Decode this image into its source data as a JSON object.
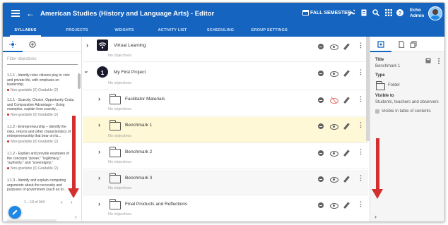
{
  "app": {
    "title": "American Studies (History and Language Arts) - Editor",
    "semester": "FALL SEMESTER",
    "user_first": "Echo",
    "user_last": "Admin"
  },
  "tabs": [
    {
      "label": "SYLLABUS",
      "active": true
    },
    {
      "label": "PROJECTS"
    },
    {
      "label": "WEIGHTS"
    },
    {
      "label": "ACTIVITY LIST"
    },
    {
      "label": "SCHEDULING"
    },
    {
      "label": "GROUP SETTINGS"
    }
  ],
  "left_panel": {
    "filter_placeholder": "Filter objectives",
    "objectives": [
      {
        "text": "1.1.1 - Identify roles citizens play in civic and private life, with emphasis on leadership.",
        "meta": "Non-gradable (0)  Gradable (2)"
      },
      {
        "text": "1.1.1 - Scarcity, Choice, Opportunity Costs, and Comparative Advantage – Using examples, explain how scarcity,...",
        "meta": "Non-gradable (0)  Gradable (2)"
      },
      {
        "text": "1.1.2 - Entrepreneurship – Identify the risks, returns and other characteristics of entrepreneurship that bear on its...",
        "meta": "Non-gradable (0)  Gradable (2)"
      },
      {
        "text": "1.1.2 - Explain and provide examples of the concepts \"power,\" \"legitimacy,\" \"authority,\" and \"sovereignty.\"",
        "meta": "Non-gradable (0)  Gradable (2)"
      },
      {
        "text": "1.1.3 - Identify and explain competing arguments about the necessity and purposes of government (such as to...",
        "meta": ""
      }
    ],
    "pager": "1 – 10 of 344"
  },
  "syllabus": {
    "rows": [
      {
        "label": "Virtual Learning",
        "sub": "No objectives",
        "icon": "wifi-icon"
      },
      {
        "label": "My First Project",
        "sub": "No objectives",
        "icon": "project-icon"
      },
      {
        "label": "Facilitator Materials",
        "sub": "No objectives",
        "icon": "folder-icon"
      },
      {
        "label": "Benchmark 1",
        "sub": "No objectives",
        "icon": "folder-icon"
      },
      {
        "label": "Benchmark 2",
        "sub": "No objectives",
        "icon": "folder-icon"
      },
      {
        "label": "Benchmark 3",
        "sub": "No objectives",
        "icon": "folder-icon"
      },
      {
        "label": "Final Products and Reflections",
        "sub": "No objectives",
        "icon": "folder-icon"
      }
    ],
    "project_icon_glyph": "1"
  },
  "right_panel": {
    "title_label": "Title",
    "title_value": "Benchmark 1",
    "type_label": "Type",
    "type_value": "Folder",
    "visible_label": "Visible to",
    "visible_value": "Students, teachers and observers",
    "visible_toc": "Visible in table of contents"
  },
  "colors": {
    "primary": "#1565c0",
    "highlight_row": "#fff8d6",
    "annotation_arrow": "#d32f2f"
  }
}
